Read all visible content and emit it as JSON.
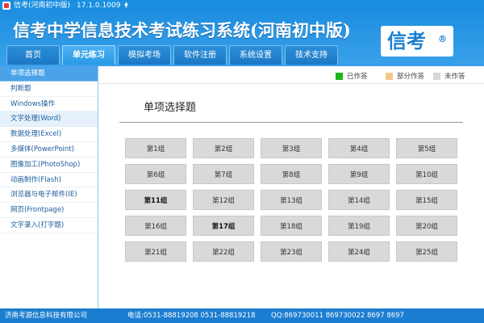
{
  "window": {
    "title": "信考(河南初中版)",
    "version": "17.1.0.1009",
    "pin_icon": "pin-icon"
  },
  "header": {
    "banner": "信考中学信息技术考试练习系统(河南初中版)",
    "logo_text": "信考",
    "logo_mark": "®"
  },
  "nav": {
    "tabs": [
      {
        "label": "首页"
      },
      {
        "label": "单元练习",
        "active": true
      },
      {
        "label": "模拟考场"
      },
      {
        "label": "软件注册"
      },
      {
        "label": "系统设置"
      },
      {
        "label": "技术支持"
      }
    ]
  },
  "sidebar": {
    "items": [
      {
        "label": "单项选择题",
        "active": true
      },
      {
        "label": "判断题"
      },
      {
        "label": "Windows操作"
      },
      {
        "label": "文字处理(Word)",
        "hover": true
      },
      {
        "label": "数据处理(Excel)"
      },
      {
        "label": "多媒体(PowerPoint)"
      },
      {
        "label": "图像加工(PhotoShop)"
      },
      {
        "label": "动画制作(Flash)"
      },
      {
        "label": "浏览器与电子邮件(IE)"
      },
      {
        "label": "网页(Frontpage)"
      },
      {
        "label": "文字录入(打字题)"
      }
    ]
  },
  "legend": [
    {
      "label": "已作答",
      "color": "#1db51d"
    },
    {
      "label": "部分作答",
      "color": "#f3c98a"
    },
    {
      "label": "未作答",
      "color": "#d6d6d6"
    }
  ],
  "main": {
    "heading": "单项选择题",
    "groups": [
      {
        "label": "第1组"
      },
      {
        "label": "第2组"
      },
      {
        "label": "第3组"
      },
      {
        "label": "第4组"
      },
      {
        "label": "第5组"
      },
      {
        "label": "第6组"
      },
      {
        "label": "第7组"
      },
      {
        "label": "第8组"
      },
      {
        "label": "第9组"
      },
      {
        "label": "第10组"
      },
      {
        "label": "第11组",
        "bold": true
      },
      {
        "label": "第12组"
      },
      {
        "label": "第13组"
      },
      {
        "label": "第14组"
      },
      {
        "label": "第15组"
      },
      {
        "label": "第16组"
      },
      {
        "label": "第17组",
        "bold": true
      },
      {
        "label": "第18组"
      },
      {
        "label": "第19组"
      },
      {
        "label": "第20组"
      },
      {
        "label": "第21组"
      },
      {
        "label": "第22组"
      },
      {
        "label": "第23组"
      },
      {
        "label": "第24组"
      },
      {
        "label": "第25组"
      }
    ]
  },
  "status": {
    "company": "济南考源信息科技有限公司",
    "phone": "电话:0531-88819208  0531-88819218",
    "qq": "QQ:869730011  869730022  8697  8697"
  }
}
